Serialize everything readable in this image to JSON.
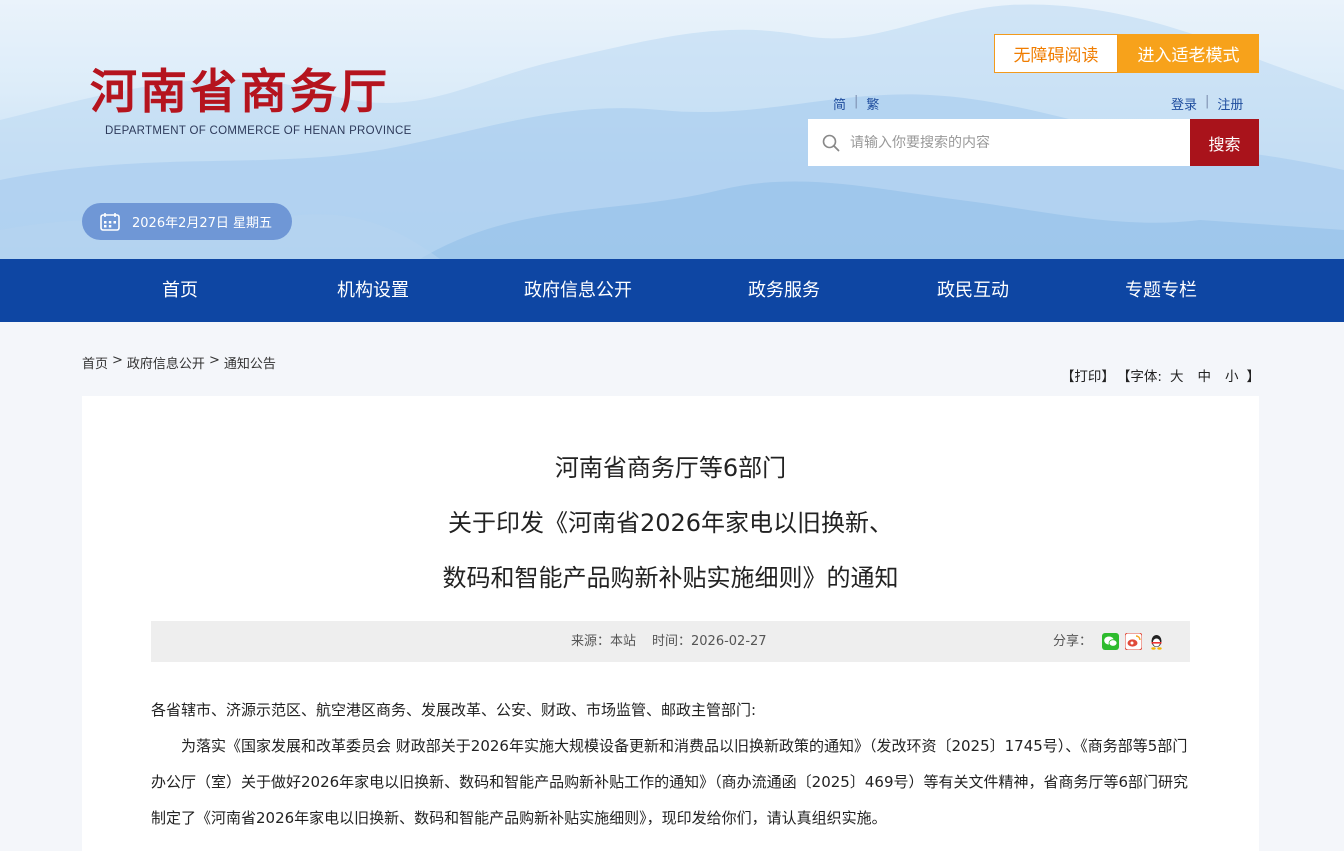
{
  "header": {
    "logo_cn": "河南省商务厅",
    "logo_en": "DEPARTMENT OF COMMERCE OF HENAN PROVINCE",
    "accessibility_label": "无障碍阅读",
    "elder_mode_label": "进入适老模式",
    "lang_simplified": "简",
    "lang_traditional": "繁",
    "login": "登录",
    "register": "注册",
    "search_placeholder": "请输入你要搜索的内容",
    "search_button": "搜索",
    "date": "2026年2月27日 星期五",
    "separator": "|"
  },
  "nav": [
    "首页",
    "机构设置",
    "政府信息公开",
    "政务服务",
    "政民互动",
    "专题专栏"
  ],
  "breadcrumb": [
    "首页",
    ">",
    "政府信息公开",
    ">",
    "通知公告"
  ],
  "tools": {
    "print": "【打印】",
    "font_label": "【字体:",
    "large": "大",
    "medium": "中",
    "small": "小",
    "close": "】"
  },
  "article": {
    "title_lines": [
      "河南省商务厅等6部门",
      "关于印发《河南省2026年家电以旧换新、",
      "数码和智能产品购新补贴实施细则》的通知"
    ],
    "source": "来源：本站",
    "time": "时间：2026-02-27",
    "share_label": "分享：",
    "salutation": "各省辖市、济源示范区、航空港区商务、发展改革、公安、财政、市场监管、邮政主管部门:",
    "paragraph": "为落实《国家发展和改革委员会 财政部关于2026年实施大规模设备更新和消费品以旧换新政策的通知》（发改环资〔2025〕1745号）、《商务部等5部门办公厅（室）关于做好2026年家电以旧换新、数码和智能产品购新补贴工作的通知》（商办流通函〔2025〕469号）等有关文件精神，省商务厅等6部门研究制定了《河南省2026年家电以旧换新、数码和智能产品购新补贴实施细则》，现印发给你们，请认真组织实施。"
  },
  "colors": {
    "brand_red": "#b5141e",
    "nav_blue": "#0e46a3",
    "elder_orange": "#f7a21b",
    "search_red": "#a9131b"
  },
  "share_icons": [
    "wechat-icon",
    "weibo-icon",
    "qq-icon"
  ]
}
